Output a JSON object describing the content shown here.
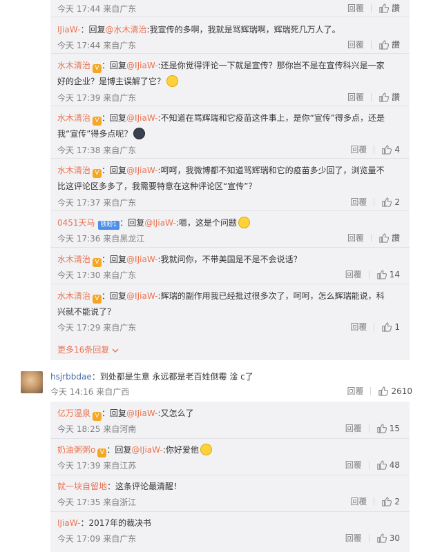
{
  "ui": {
    "reply_label": "回覆",
    "more_replies": "更多16条回复",
    "at_prefix": "@",
    "reply_prefix": "回复"
  },
  "thread1": [
    {
      "name": "",
      "text": "",
      "meta": "今天 17:44 来自广东",
      "likes": "讚",
      "is_top_partial": true
    },
    {
      "name": "IJiaW-",
      "to": "水木清治",
      "text": ":我宣传的多啊，我就是骂辉瑞啊，辉瑞死几万人了。",
      "meta": "今天 17:44 来自广东",
      "likes": "讚"
    },
    {
      "name": "水木清治",
      "to": "IJiaW-",
      "text": ":还是你觉得评论一下就是宣传？那你岂不是在宣传科兴是一家好的企业？是博主误解了它？",
      "meta": "今天 17:39 来自广东",
      "likes": "讚",
      "emoji": "sick"
    },
    {
      "name": "水木清治",
      "to": "IJiaW-",
      "text": ":不知道在骂辉瑞和它疫苗这件事上，是你“宣传”得多点，还是我“宣传”得多点呢？",
      "meta": "今天 17:38 来自广东",
      "likes": "4",
      "emoji": "dark"
    },
    {
      "name": "水木清治",
      "to": "IJiaW-",
      "text": ":呵呵，我微博都不知道骂辉瑞和它的疫苗多少回了，浏览量不比这评论区多多了，我需要特意在这种评论区“宣传”？",
      "meta": "今天 17:37 来自广东",
      "likes": "2"
    },
    {
      "name": "0451天马",
      "to": "IJiaW-",
      "text": ":嗯，这是个问题",
      "meta": "今天 17:36 来自黑龙江",
      "likes": "讚",
      "fan_badge": "铁粉1",
      "emoji": "yellow"
    },
    {
      "name": "水木清治",
      "to": "IJiaW-",
      "text": ":我就问你，不带美国是不是不会说话？",
      "meta": "今天 17:30 来自广东",
      "likes": "14"
    },
    {
      "name": "水木清治",
      "to": "IJiaW-",
      "text": ":辉瑞的副作用我已经批过很多次了，呵呵，怎么辉瑞能说，科兴就不能说了？",
      "meta": "今天 17:29 来自广东",
      "likes": "1"
    }
  ],
  "main_comment": {
    "name": "hsjrbbdae",
    "text": "：到处都是生意 永远都是老百姓倒霉 淦 c了",
    "meta": "今天 14:16 来自广西",
    "likes": "2610"
  },
  "thread2": [
    {
      "name": "亿万温泉",
      "to": "IJiaW-",
      "text": ":又怎么了",
      "meta": "今天 18:25 来自河南",
      "likes": "15"
    },
    {
      "name": "奶油粥粥o",
      "to": "IJiaW-",
      "text": ":你好爱他",
      "meta": "今天 17:39 来自江苏",
      "likes": "48",
      "emoji": "yellow"
    },
    {
      "name": "就一块自留地",
      "text": "：这条评论最清醒！",
      "meta": "今天 17:35 来自浙江",
      "likes": "2"
    },
    {
      "name": "IJiaW-",
      "text": "：2017年的裁决书",
      "meta": "今天 17:09 来自广东",
      "likes": "30"
    }
  ],
  "colors": {
    "accent": "#eb7350",
    "panel_bg": "#f2f2f5",
    "meta": "#808080"
  }
}
